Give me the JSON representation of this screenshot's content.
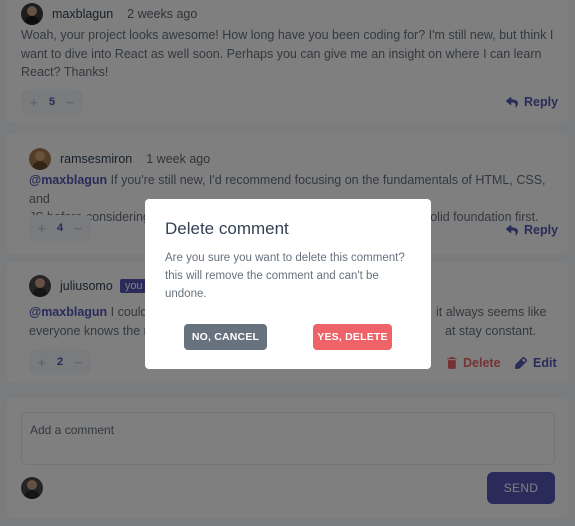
{
  "comments": [
    {
      "username": "maxblagun",
      "time": "2 weeks ago",
      "text": "Woah, your project looks awesome! How long have you been coding for? I'm still new, but think I want to dive into React as well soon. Perhaps you can give me an insight on where I can learn React? Thanks!",
      "score": "5",
      "plus": "+",
      "minus": "−",
      "reply_label": "Reply"
    },
    {
      "username": "ramsesmiron",
      "time": "1 week ago",
      "mention": "@maxblagun",
      "text_line1": " If you're still new, I'd recommend focusing on the fundamentals of HTML, CSS, and",
      "text_line2": "JS before considering React. It's very tempting to jump ahead but lay a solid foundation first.",
      "score": "4",
      "plus": "+",
      "minus": "−",
      "reply_label": "Reply"
    },
    {
      "username": "juliusomo",
      "you_badge": "you",
      "mention": "@maxblagun",
      "text_line1_start": " I could",
      "text_line1_end": "it always seems like",
      "text_line2_start": "everyone knows the n",
      "text_line2_end": "at stay constant.",
      "score": "2",
      "plus": "+",
      "minus": "−",
      "delete_label": "Delete",
      "edit_label": "Edit"
    }
  ],
  "modal": {
    "title": "Delete comment",
    "body": "Are you sure you want to delete this comment? this will remove the comment and can't be undone.",
    "cancel_label": "NO, CANCEL",
    "confirm_label": "YES, DELETE"
  },
  "composer": {
    "placeholder": "Add a comment",
    "send_label": "SEND"
  },
  "colors": {
    "primary": "#5457b6",
    "danger": "#ed6368",
    "cancel": "#67727e",
    "background": "#f5f6fa"
  },
  "icons": {
    "reply": "reply-arrow-icon",
    "delete": "trash-icon",
    "edit": "pencil-icon",
    "avatar": "user-avatar"
  }
}
